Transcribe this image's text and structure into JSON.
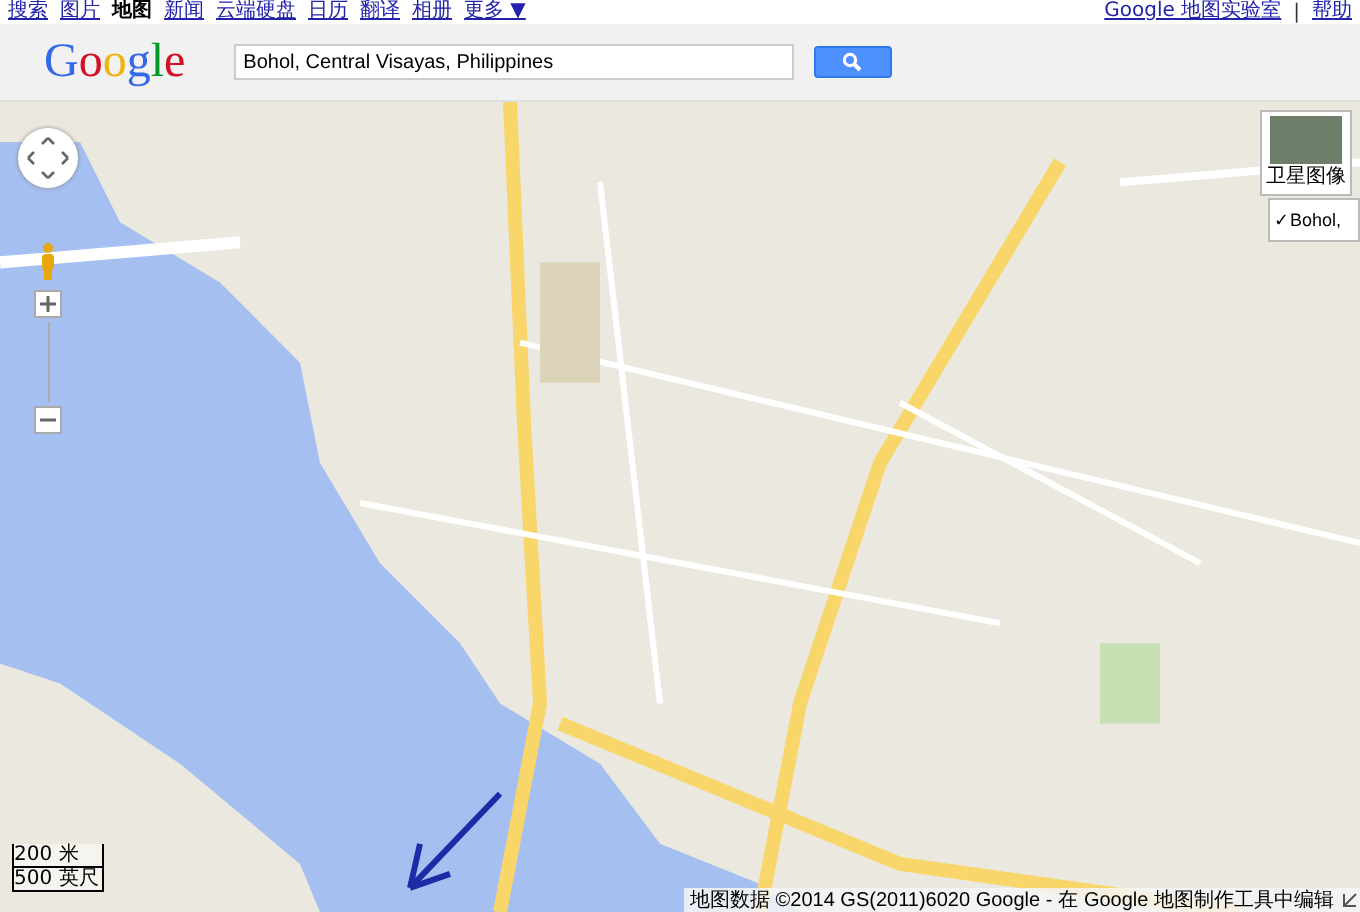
{
  "top_nav": [
    {
      "label": "搜索",
      "selected": false
    },
    {
      "label": "图片",
      "selected": false
    },
    {
      "label": "地图",
      "selected": true
    },
    {
      "label": "新闻",
      "selected": false
    },
    {
      "label": "云端硬盘",
      "selected": false
    },
    {
      "label": "日历",
      "selected": false
    },
    {
      "label": "翻译",
      "selected": false
    },
    {
      "label": "相册",
      "selected": false
    },
    {
      "label": "更多 ▼",
      "selected": false
    }
  ],
  "top_links": [
    "Google 地图实验室",
    "帮助"
  ],
  "link_separator": "|",
  "logo": "Google",
  "search": {
    "value": "Bohol, Central Visayas, Philippines"
  },
  "map_type": {
    "label": "卫星图像"
  },
  "layer": {
    "label": "Bohol,",
    "check_mark": "✓",
    "checked": true
  },
  "scale": [
    "200 米",
    "500 英尺"
  ],
  "attribution": "地图数据 ©2014 GS(2011)6020 Google - ",
  "edit_link": "在 Google 地图制作工具中编辑"
}
